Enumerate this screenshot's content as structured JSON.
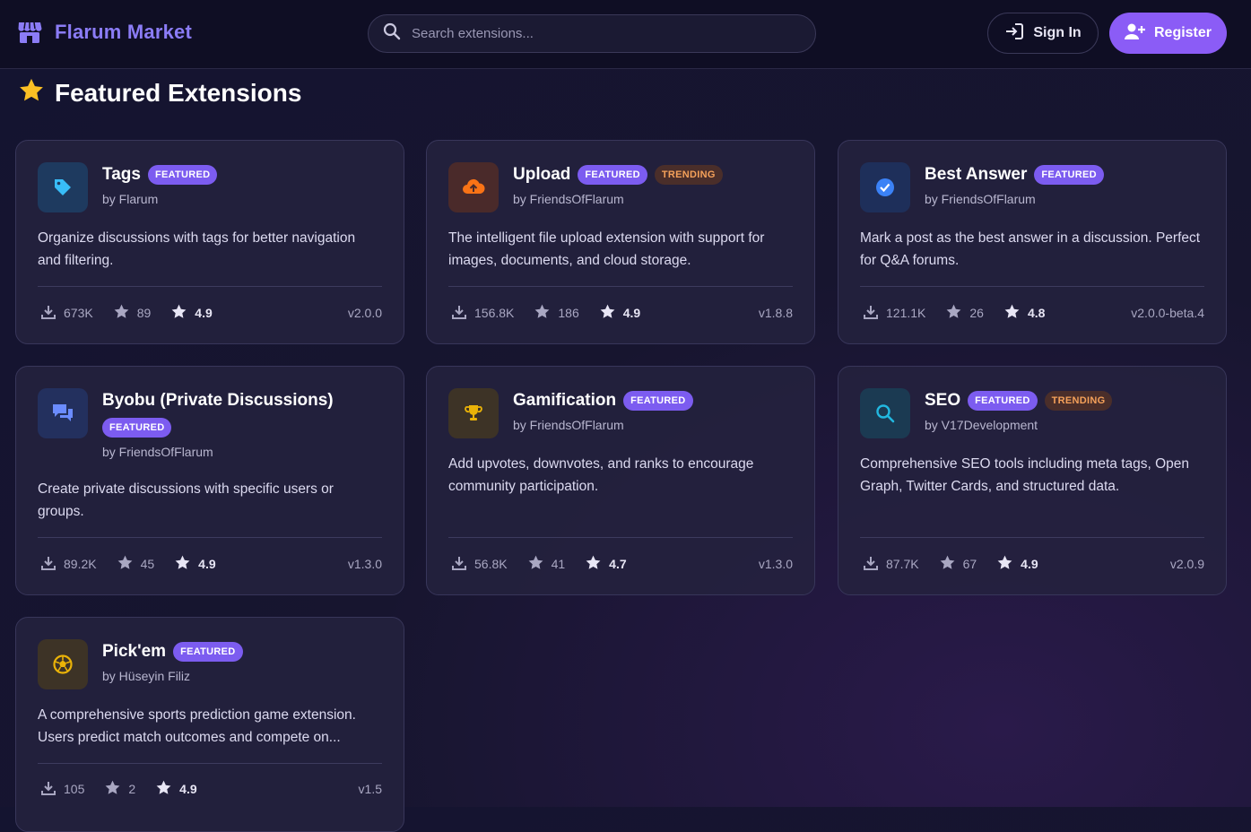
{
  "header": {
    "brand": "Flarum Market",
    "search_placeholder": "Search extensions...",
    "signin_label": "Sign In",
    "register_label": "Register"
  },
  "section": {
    "title": "Featured Extensions"
  },
  "extensions": [
    {
      "name": "Tags",
      "badges": [
        "FEATURED"
      ],
      "author": "by Flarum",
      "description": "Organize discussions with tags for better navigation and filtering.",
      "downloads": "673K",
      "stars": "89",
      "rating": "4.9",
      "version": "v2.0.0",
      "icon": "tag-icon",
      "icon_color": "#38bdf8",
      "icon_bg": "#1e3a5f"
    },
    {
      "name": "Upload",
      "badges": [
        "FEATURED",
        "TRENDING"
      ],
      "author": "by FriendsOfFlarum",
      "description": "The intelligent file upload extension with support for images, documents, and cloud storage.",
      "downloads": "156.8K",
      "stars": "186",
      "rating": "4.9",
      "version": "v1.8.8",
      "icon": "cloud-upload-icon",
      "icon_color": "#f97316",
      "icon_bg": "#4a2a2a"
    },
    {
      "name": "Best Answer",
      "badges": [
        "FEATURED"
      ],
      "author": "by FriendsOfFlarum",
      "description": "Mark a post as the best answer in a discussion. Perfect for Q&A forums.",
      "downloads": "121.1K",
      "stars": "26",
      "rating": "4.8",
      "version": "v2.0.0-beta.4",
      "icon": "check-circle-icon",
      "icon_color": "#3b82f6",
      "icon_bg": "#1e2f5a"
    },
    {
      "name": "Byobu (Private Discussions)",
      "badges": [
        "FEATURED"
      ],
      "author": "by FriendsOfFlarum",
      "description": "Create private discussions with specific users or groups.",
      "downloads": "89.2K",
      "stars": "45",
      "rating": "4.9",
      "version": "v1.3.0",
      "icon": "chat-bubbles-icon",
      "icon_color": "#6b8cff",
      "icon_bg": "#23305e"
    },
    {
      "name": "Gamification",
      "badges": [
        "FEATURED"
      ],
      "author": "by FriendsOfFlarum",
      "description": "Add upvotes, downvotes, and ranks to encourage community participation.",
      "downloads": "56.8K",
      "stars": "41",
      "rating": "4.7",
      "version": "v1.3.0",
      "icon": "trophy-icon",
      "icon_color": "#eab308",
      "icon_bg": "#3d3326"
    },
    {
      "name": "SEO",
      "badges": [
        "FEATURED",
        "TRENDING"
      ],
      "author": "by V17Development",
      "description": "Comprehensive SEO tools including meta tags, Open Graph, Twitter Cards, and structured data.",
      "downloads": "87.7K",
      "stars": "67",
      "rating": "4.9",
      "version": "v2.0.9",
      "icon": "search-icon",
      "icon_color": "#22b8e0",
      "icon_bg": "#1b3a52"
    },
    {
      "name": "Pick'em",
      "badges": [
        "FEATURED"
      ],
      "author": "by Hüseyin Filiz",
      "description": "A comprehensive sports prediction game extension. Users predict match outcomes and compete on...",
      "downloads": "105",
      "stars": "2",
      "rating": "4.9",
      "version": "v1.5",
      "icon": "soccer-ball-icon",
      "icon_color": "#eab308",
      "icon_bg": "#3d3326"
    }
  ]
}
